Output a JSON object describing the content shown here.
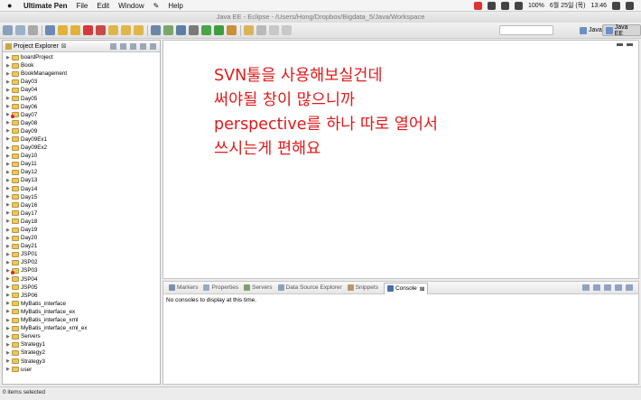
{
  "menubar": {
    "app_name": "Ultimate Pen",
    "items": [
      "File",
      "Edit",
      "Window",
      "Help"
    ],
    "battery": "100%",
    "date": "6월 25일 (목)",
    "time": "13:46"
  },
  "window": {
    "title": "Java EE - Eclipse - /Users/Hong/Dropbox/Bigdata_5/Java/Workspace"
  },
  "perspectives": {
    "java": "Java",
    "java_ee": "Java EE"
  },
  "explorer": {
    "title": "Project Explorer",
    "close_glyph": "⊠",
    "projects": [
      "boardProject",
      "Book",
      "BookManagement",
      "Day03",
      "Day04",
      "Day05",
      "Day06",
      "Day07",
      "Day08",
      "Day09",
      "Day09Ex1",
      "Day09Ex2",
      "Day10",
      "Day11",
      "Day12",
      "Day13",
      "Day14",
      "Day15",
      "Day16",
      "Day17",
      "Day18",
      "Day19",
      "Day20",
      "Day21",
      "JSP01",
      "JSP02",
      "JSP03",
      "JSP04",
      "JSP05",
      "JSP06",
      "MyBatis_interface",
      "MyBatis_interface_ex",
      "MyBatis_interface_xml",
      "MyBatis_interface_xml_ex",
      "Servers",
      "Strategy1",
      "Strategy2",
      "Strategy3",
      "user"
    ]
  },
  "editor": {
    "annotation": [
      "SVN툴을 사용해보실건데",
      "써야될 창이 많으니까",
      "perspective를 하나 따로 열어서",
      "쓰시는게 편해요"
    ]
  },
  "console_panel": {
    "tabs": [
      "Markers",
      "Properties",
      "Servers",
      "Data Source Explorer",
      "Snippets",
      "Console"
    ],
    "active_tab": "Console",
    "message": "No consoles to display at this time."
  },
  "statusbar": {
    "text": "0 items selected"
  },
  "colors": {
    "annotation": "#e01a1a",
    "folder": "#e8c766"
  }
}
